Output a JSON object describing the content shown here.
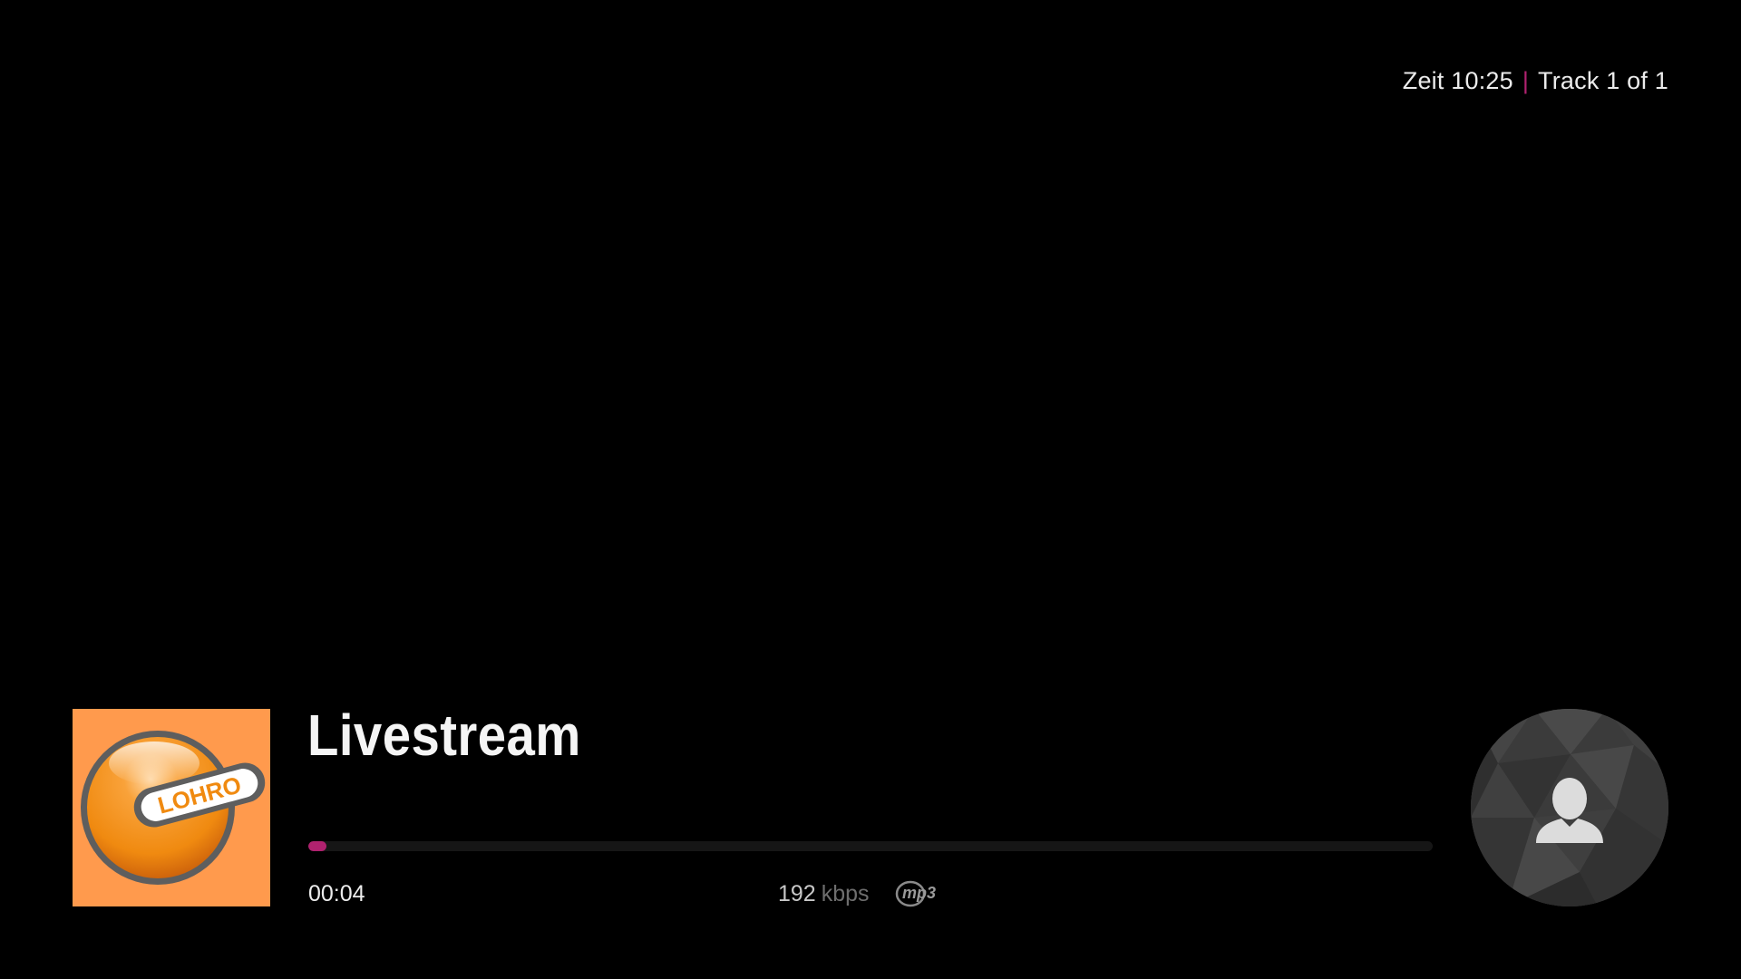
{
  "header": {
    "time_label": "Zeit 10:25",
    "separator": "|",
    "track_label": "Track 1 of 1"
  },
  "now_playing": {
    "title": "Livestream",
    "artwork_logo_text": "LOHRO",
    "elapsed": "00:04",
    "progress_fraction": 0.013,
    "bitrate_value": "192",
    "bitrate_unit": "kbps",
    "codec_icon": "mp3-icon",
    "artist_placeholder_icon": "person-icon"
  },
  "colors": {
    "background": "#000000",
    "accent": "#b0226f",
    "artwork_orange": "#ff9a4d"
  }
}
